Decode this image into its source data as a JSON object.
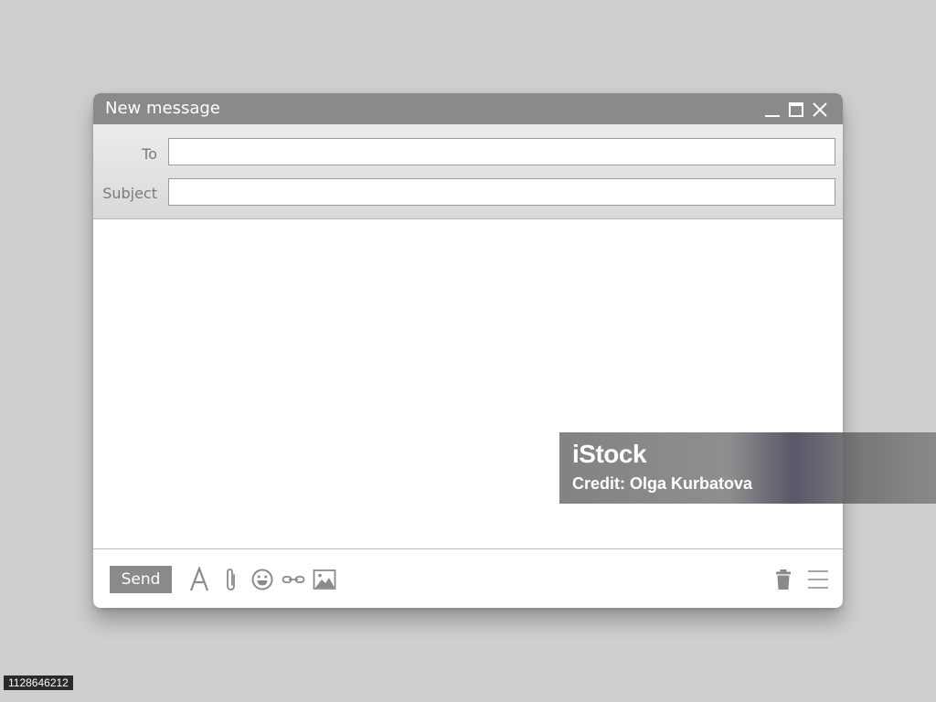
{
  "window": {
    "title": "New message",
    "controls": [
      "minimize-icon",
      "maximize-icon",
      "close-icon"
    ]
  },
  "fields": {
    "to": {
      "label": "To",
      "value": "",
      "placeholder": ""
    },
    "subject": {
      "label": "Subject",
      "value": "",
      "placeholder": ""
    }
  },
  "body": {
    "value": ""
  },
  "toolbar": {
    "send_label": "Send",
    "tools": [
      "text-format-icon",
      "paperclip-icon",
      "emoji-icon",
      "link-icon",
      "image-icon"
    ],
    "right_tools": [
      "trash-icon",
      "menu-icon"
    ]
  },
  "watermark": {
    "logo": "iStock",
    "credit": "Credit: Olga Kurbatova"
  },
  "image_id": "1128646212",
  "colors": {
    "background": "#cfcfcf",
    "titlebar": "#8a8a8a",
    "send_button": "#8a8a8a",
    "icon": "#8a8a8a"
  }
}
